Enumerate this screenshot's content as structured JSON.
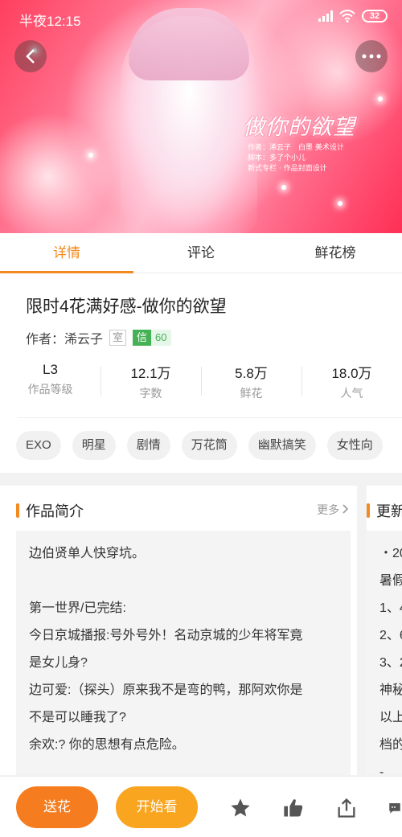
{
  "status_bar": {
    "time": "半夜12:15",
    "battery": "32"
  },
  "hero": {
    "title": "做你的欲望",
    "credits": [
      "作者：浠云子　白墨 美术设计",
      "脚本：多了个小儿",
      "新式专栏 · 作品封面设计"
    ]
  },
  "tabs": [
    {
      "label": "详情"
    },
    {
      "label": "评论"
    },
    {
      "label": "鲜花榜"
    }
  ],
  "book": {
    "title": "限时4花满好感-做你的欲望",
    "author_label": "作者：浠云子",
    "room_badge": "室",
    "trust_badge": {
      "icon": "信",
      "value": "60"
    }
  },
  "stats": [
    {
      "value": "L3",
      "label": "作品等级"
    },
    {
      "value": "12.1万",
      "label": "字数"
    },
    {
      "value": "5.8万",
      "label": "鲜花"
    },
    {
      "value": "18.0万",
      "label": "人气"
    }
  ],
  "tags": [
    "EXO",
    "明星",
    "剧情",
    "万花筒",
    "幽默搞笑",
    "女性向"
  ],
  "intro": {
    "heading": "作品简介",
    "more": "更多",
    "lines": [
      "边伯贤单人快穿坑。",
      "",
      "第一世界/已完结:",
      "今日京城播报:号外号外！名动京城的少年将军竟",
      "是女儿身?",
      "边可爱:（探头）原来我不是弯的鸭，那阿欢你是",
      "不是可以睡我了?",
      "余欢:? 你的思想有点危险。"
    ]
  },
  "news": {
    "heading": "更新",
    "lines": [
      "・20",
      "暑假",
      "1、4",
      "2、6",
      "3、2",
      "神秘",
      "以上",
      "档的",
      "-"
    ]
  },
  "bottom": {
    "send_label": "送花",
    "start_label": "开始看"
  },
  "colors": {
    "accent": "#f28a1f",
    "send": "#f57d1f",
    "start": "#f9a51f",
    "trust": "#45b155"
  }
}
